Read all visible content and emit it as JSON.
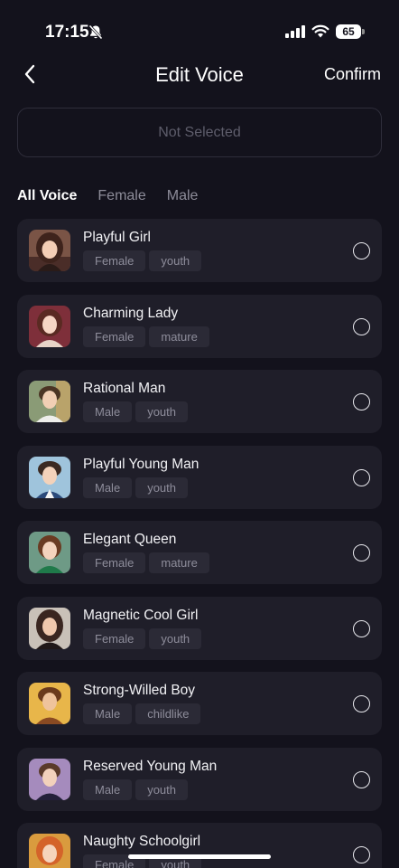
{
  "status": {
    "time": "17:15",
    "battery": "65",
    "icons": [
      "bell-slash-icon",
      "signal-icon",
      "wifi-icon",
      "battery-icon"
    ]
  },
  "header": {
    "title": "Edit Voice",
    "confirm_label": "Confirm",
    "back_icon": "chevron-left-icon"
  },
  "selection": {
    "placeholder": "Not Selected"
  },
  "tabs": [
    {
      "label": "All Voice",
      "active": true
    },
    {
      "label": "Female",
      "active": false
    },
    {
      "label": "Male",
      "active": false
    }
  ],
  "voices": [
    {
      "name": "Playful Girl",
      "tags": [
        "Female",
        "youth"
      ]
    },
    {
      "name": "Charming Lady",
      "tags": [
        "Female",
        "mature"
      ]
    },
    {
      "name": "Rational Man",
      "tags": [
        "Male",
        "youth"
      ]
    },
    {
      "name": "Playful Young Man",
      "tags": [
        "Male",
        "youth"
      ]
    },
    {
      "name": "Elegant Queen",
      "tags": [
        "Female",
        "mature"
      ]
    },
    {
      "name": "Magnetic Cool Girl",
      "tags": [
        "Female",
        "youth"
      ]
    },
    {
      "name": "Strong-Willed Boy",
      "tags": [
        "Male",
        "childlike"
      ]
    },
    {
      "name": "Reserved Young Man",
      "tags": [
        "Male",
        "youth"
      ]
    },
    {
      "name": "Naughty Schoolgirl",
      "tags": [
        "Female",
        "youth"
      ]
    }
  ],
  "colors": {
    "background": "#13121c",
    "card": "#1f1e29",
    "tag": "#2b2a36",
    "tag_text": "#8e8d9b"
  }
}
